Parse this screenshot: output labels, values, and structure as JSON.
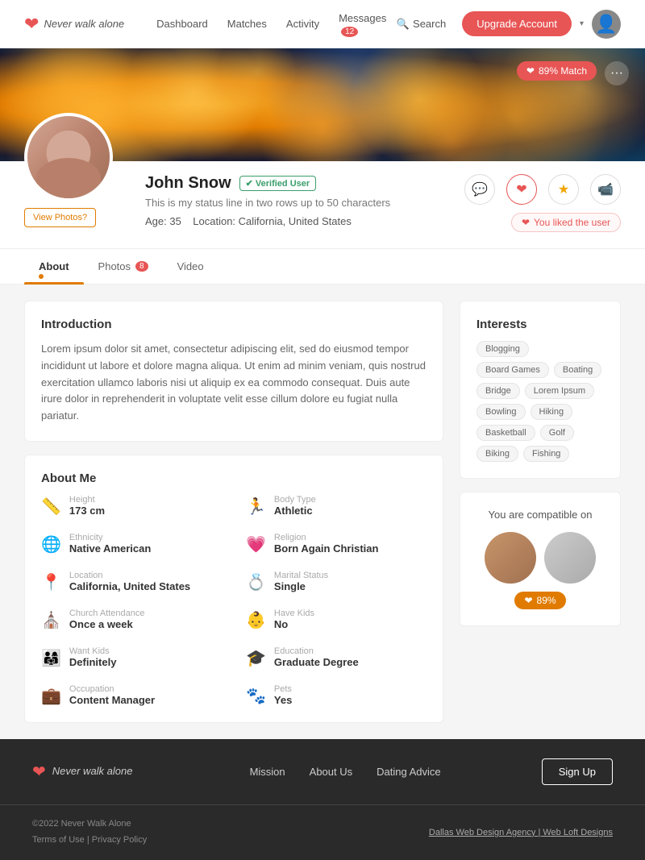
{
  "brand": {
    "name": "Never walk alone",
    "logo_icon": "❤"
  },
  "navbar": {
    "links": [
      {
        "label": "Dashboard",
        "id": "dashboard"
      },
      {
        "label": "Matches",
        "id": "matches"
      },
      {
        "label": "Activity",
        "id": "activity"
      },
      {
        "label": "Messages",
        "id": "messages",
        "badge": "12"
      }
    ],
    "search_label": "Search",
    "upgrade_btn": "Upgrade Account"
  },
  "hero": {
    "match_pct": "89% Match",
    "more_icon": "•••"
  },
  "profile": {
    "name": "John Snow",
    "verified_label": "Verified User",
    "status_line": "This is my status line in two rows up to 50 characters",
    "age_label": "Age: 35",
    "location": "Location: California, United States",
    "view_photos_btn": "View Photos?",
    "liked_label": "You liked the user"
  },
  "tabs": [
    {
      "label": "About",
      "id": "about",
      "active": true
    },
    {
      "label": "Photos",
      "id": "photos",
      "badge": "8"
    },
    {
      "label": "Video",
      "id": "video"
    }
  ],
  "introduction": {
    "title": "Introduction",
    "text": "Lorem ipsum dolor sit amet, consectetur adipiscing elit, sed do eiusmod tempor incididunt ut labore et dolore magna aliqua. Ut enim ad minim veniam, quis nostrud exercitation ullamco laboris nisi ut aliquip ex ea commodo consequat. Duis aute irure dolor in reprehenderit in voluptate velit esse cillum dolore eu fugiat nulla pariatur."
  },
  "about_me": {
    "title": "About Me",
    "fields": [
      {
        "label": "Height",
        "value": "173 cm",
        "icon": "📏"
      },
      {
        "label": "Body Type",
        "value": "Athletic",
        "icon": "🏃"
      },
      {
        "label": "Ethnicity",
        "value": "Native American",
        "icon": "🌐"
      },
      {
        "label": "Religion",
        "value": "Born Again Christian",
        "icon": "💗"
      },
      {
        "label": "Location",
        "value": "California, United States",
        "icon": "📍"
      },
      {
        "label": "Marital Status",
        "value": "Single",
        "icon": "💍"
      },
      {
        "label": "Church Attendance",
        "value": "Once a week",
        "icon": "⛪"
      },
      {
        "label": "Have Kids",
        "value": "No",
        "icon": "👶"
      },
      {
        "label": "Want Kids",
        "value": "Definitely",
        "icon": "👨‍👩‍👧"
      },
      {
        "label": "Education",
        "value": "Graduate Degree",
        "icon": "🎓"
      },
      {
        "label": "Occupation",
        "value": "Content Manager",
        "icon": "💼"
      },
      {
        "label": "Pets",
        "value": "Yes",
        "icon": "🐾"
      }
    ]
  },
  "interests": {
    "title": "Interests",
    "tags": [
      "Blogging",
      "Board Games",
      "Boating",
      "Bridge",
      "Lorem Ipsum",
      "Bowling",
      "Hiking",
      "Basketball",
      "Golf",
      "Biking",
      "Fishing"
    ]
  },
  "compatible": {
    "title": "You are compatible on",
    "pct": "89%",
    "heart_icon": "❤"
  },
  "footer": {
    "logo_name": "Never walk alone",
    "links": [
      {
        "label": "Mission",
        "id": "mission"
      },
      {
        "label": "About Us",
        "id": "about-us"
      },
      {
        "label": "Dating Advice",
        "id": "dating-advice"
      }
    ],
    "signup_btn": "Sign Up",
    "copyright": "©2022 Never Walk Alone",
    "terms": "Terms of Use | Privacy Policy",
    "credit": "Dallas Web Design Agency | Web Loft Designs"
  }
}
